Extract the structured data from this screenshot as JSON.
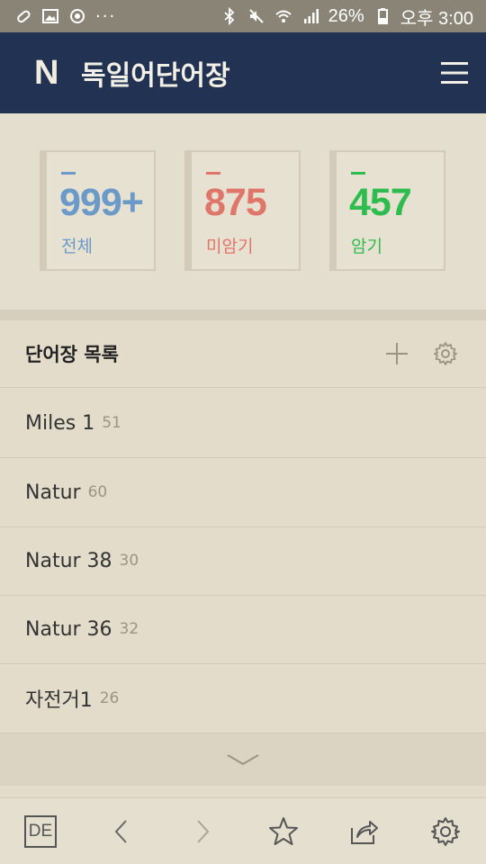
{
  "statusbar": {
    "dots": "···",
    "battery": "26%",
    "time": "오후 3:00"
  },
  "appbar": {
    "logo": "N",
    "title": "독일어단어장",
    "menu_icon": "hamburger-menu-icon"
  },
  "stats": [
    {
      "value": "999+",
      "label": "전체",
      "color": "#6b99c8"
    },
    {
      "value": "875",
      "label": "미암기",
      "color": "#e0756a"
    },
    {
      "value": "457",
      "label": "암기",
      "color": "#2fbc4e"
    }
  ],
  "list": {
    "title": "단어장 목록",
    "add_icon": "plus-icon",
    "settings_icon": "gear-icon",
    "items": [
      {
        "name": "Miles 1",
        "count": "51"
      },
      {
        "name": "Natur",
        "count": "60"
      },
      {
        "name": "Natur 38",
        "count": "30"
      },
      {
        "name": "Natur 36",
        "count": "32"
      },
      {
        "name": "자전거1",
        "count": "26"
      }
    ],
    "expand_icon": "chevron-down-icon"
  },
  "toolbar": {
    "language": "DE",
    "icons": [
      "back-icon",
      "forward-icon",
      "star-icon",
      "share-icon",
      "gear-icon"
    ]
  }
}
